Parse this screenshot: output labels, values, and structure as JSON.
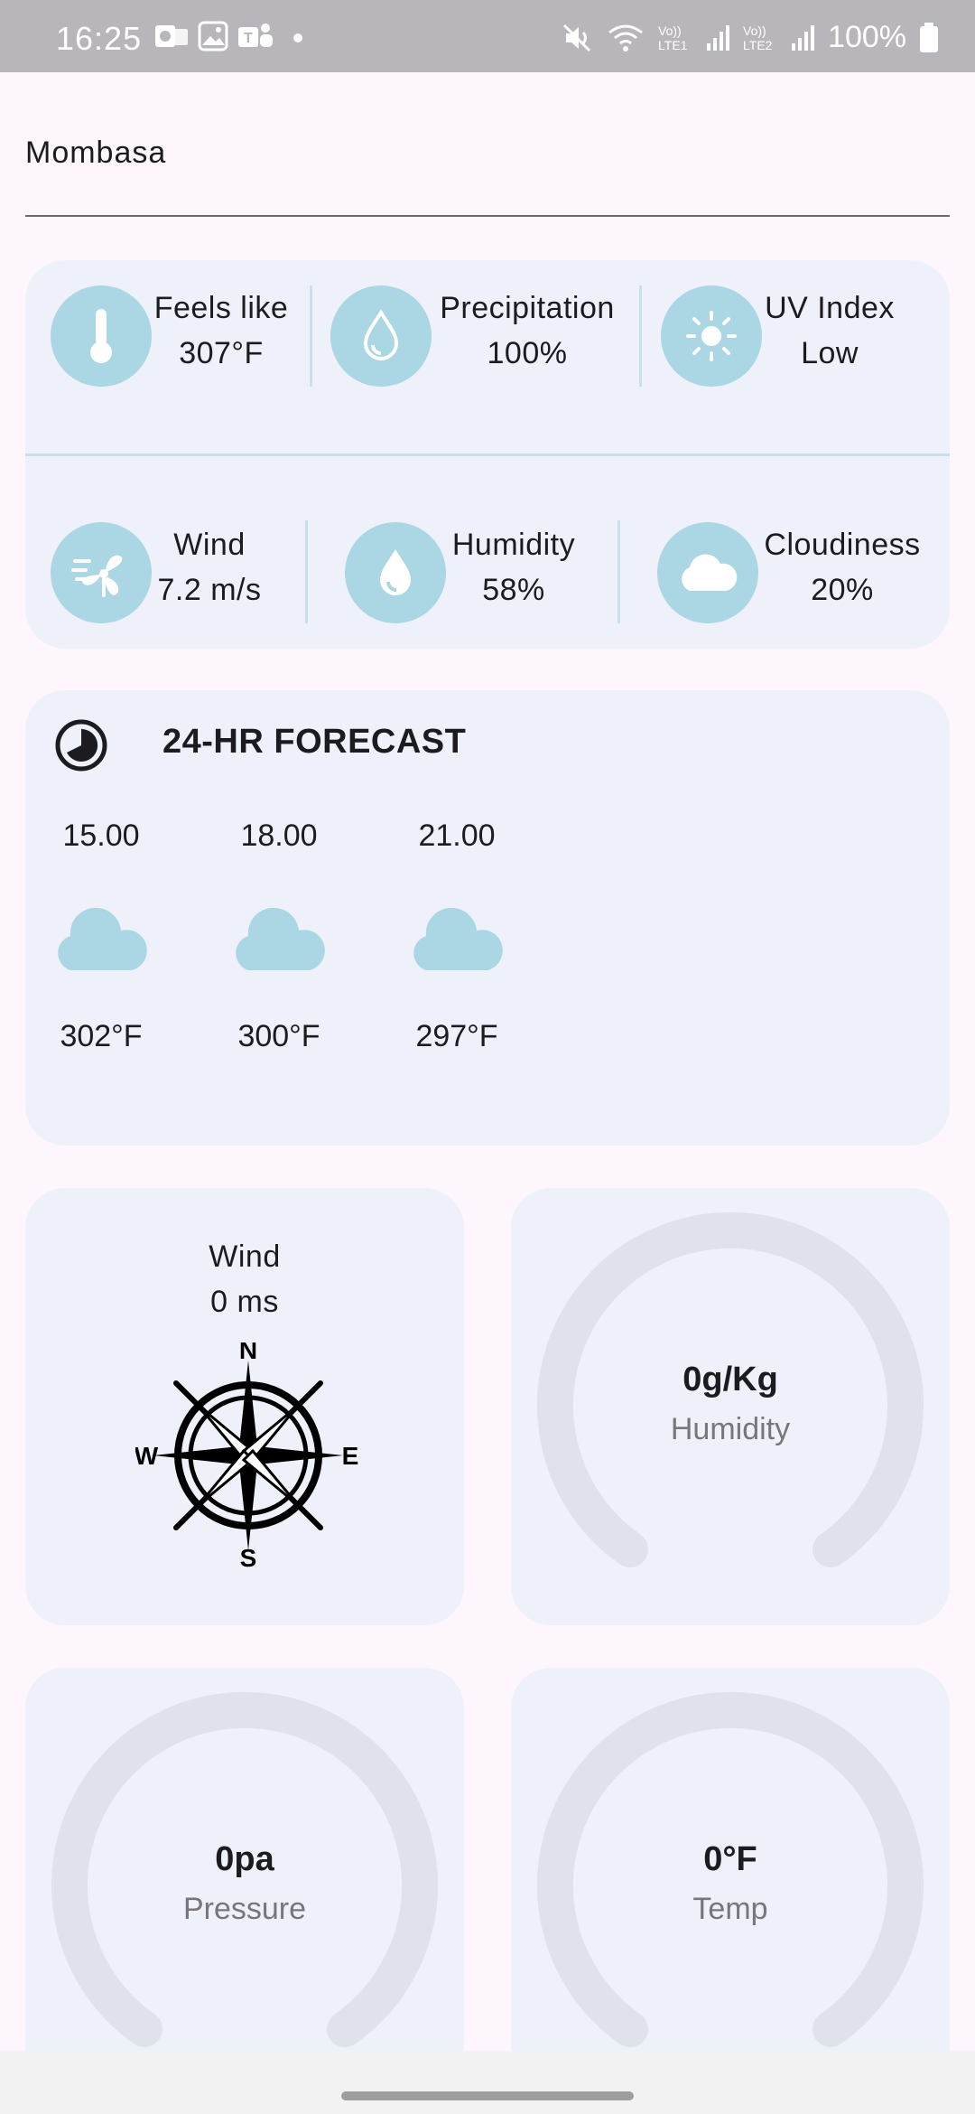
{
  "status": {
    "time": "16:25",
    "battery": "100%",
    "net1": "Vo)) LTE1",
    "net2": "Vo)) LTE2"
  },
  "location": {
    "city": "Mombasa"
  },
  "metrics_row1": [
    {
      "label": "Feels like",
      "value": "307°F",
      "icon": "thermometer-icon"
    },
    {
      "label": "Precipitation",
      "value": "100%",
      "icon": "droplet-icon"
    },
    {
      "label": "UV Index",
      "value": "Low",
      "icon": "sun-icon"
    }
  ],
  "metrics_row2": [
    {
      "label": "Wind",
      "value": "7.2 m/s",
      "icon": "wind-fan-icon"
    },
    {
      "label": "Humidity",
      "value": "58%",
      "icon": "humidity-drop-icon"
    },
    {
      "label": "Cloudiness",
      "value": "20%",
      "icon": "cloud-icon"
    }
  ],
  "forecast": {
    "title": "24-HR FORECAST",
    "items": [
      {
        "time": "15.00",
        "temp": "302°F"
      },
      {
        "time": "18.00",
        "temp": "300°F"
      },
      {
        "time": "21.00",
        "temp": "297°F"
      }
    ]
  },
  "compass": {
    "label": "Wind",
    "value": "0 ms",
    "n": "N",
    "s": "S",
    "e": "E",
    "w": "W"
  },
  "gauges": {
    "humidity": {
      "value": "0g/Kg",
      "label": "Humidity",
      "fraction": 0
    },
    "pressure": {
      "value": "0pa",
      "label": "Pressure",
      "fraction": 0
    },
    "temp": {
      "value": "0°F",
      "label": "Temp",
      "fraction": 0
    }
  },
  "colors": {
    "accent": "#abd6e3",
    "card": "#eef1f9",
    "gauge_track": "#dfe2ea"
  }
}
